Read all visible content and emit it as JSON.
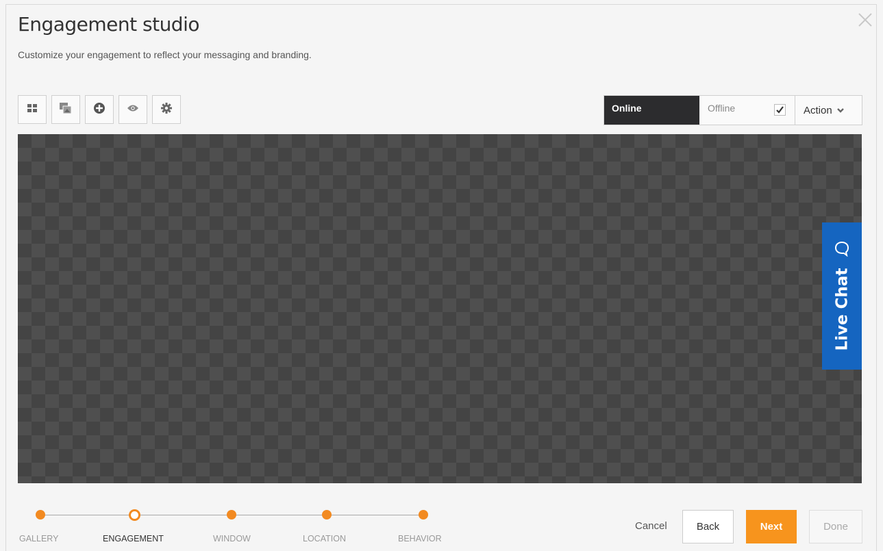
{
  "header": {
    "title": "Engagement studio",
    "subtitle": "Customize your engagement to reflect your messaging and branding."
  },
  "toolbar": {
    "buttons": [
      {
        "icon": "layout-grid-icon"
      },
      {
        "icon": "image-edit-icon"
      },
      {
        "icon": "add-circle-icon"
      },
      {
        "icon": "eye-icon"
      },
      {
        "icon": "gear-icon"
      }
    ]
  },
  "status": {
    "online_label": "Online",
    "offline_label": "Offline",
    "offline_checked": true,
    "action_label": "Action"
  },
  "preview": {
    "live_chat_label": "Live Chat",
    "live_chat_color": "#1565c0"
  },
  "wizard": {
    "steps": [
      {
        "label": "GALLERY",
        "state": "done"
      },
      {
        "label": "ENGAGEMENT",
        "state": "current"
      },
      {
        "label": "WINDOW",
        "state": "pending"
      },
      {
        "label": "LOCATION",
        "state": "pending"
      },
      {
        "label": "BEHAVIOR",
        "state": "pending"
      }
    ],
    "accent_color": "#f28a21"
  },
  "footer": {
    "cancel_label": "Cancel",
    "back_label": "Back",
    "next_label": "Next",
    "done_label": "Done"
  }
}
